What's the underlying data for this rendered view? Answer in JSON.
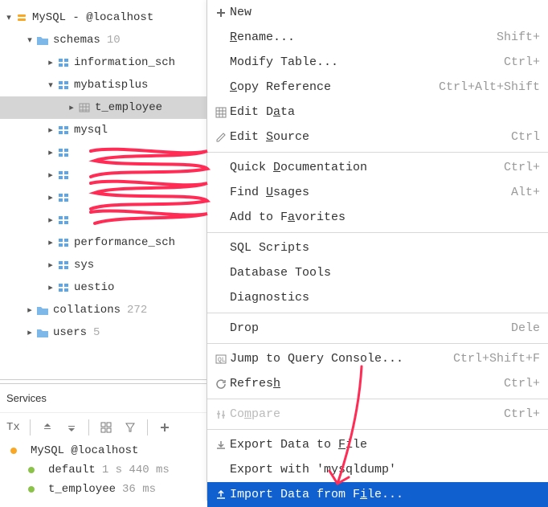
{
  "tree": {
    "root_label": "MySQL - @localhost",
    "schemas": {
      "label": "schemas",
      "count": "10",
      "items": [
        {
          "label": "information_sch",
          "expanded": false
        },
        {
          "label": "mybatisplus",
          "expanded": true,
          "children": [
            {
              "label": "t_employee"
            }
          ]
        },
        {
          "label": "mysql",
          "expanded": false
        },
        {
          "label": "",
          "redacted": true
        },
        {
          "label": "",
          "redacted": true
        },
        {
          "label": "",
          "redacted": true
        },
        {
          "label": "",
          "redacted": true
        },
        {
          "label": "performance_sch",
          "expanded": false
        },
        {
          "label": "sys",
          "expanded": false
        },
        {
          "label": "uestio",
          "expanded": false
        }
      ]
    },
    "collations": {
      "label": "collations",
      "count": "272"
    },
    "users": {
      "label": "users",
      "count": "5"
    }
  },
  "services": {
    "title": "Services",
    "label_tx": "Tx",
    "lines": [
      {
        "text": "MySQL  @localhost"
      },
      {
        "text": "default",
        "meta": "1 s 440 ms"
      },
      {
        "text": "t_employee",
        "meta": "36 ms"
      }
    ]
  },
  "menu": {
    "items": [
      {
        "label_html": "New",
        "icon": "plus"
      },
      {
        "label_html": "<u>R</u>ename...",
        "shortcut": "Shift+"
      },
      {
        "label_html": "Modify Table...",
        "shortcut": "Ctrl+"
      },
      {
        "label_html": "<u>C</u>opy Reference",
        "shortcut": "Ctrl+Alt+Shift"
      },
      {
        "label_html": "Edit D<u>a</u>ta",
        "icon": "grid"
      },
      {
        "label_html": "Edit <u>S</u>ource",
        "icon": "pencil",
        "shortcut": "Ctrl"
      },
      {
        "type": "sep"
      },
      {
        "label_html": "Quick <u>D</u>ocumentation",
        "shortcut": "Ctrl+"
      },
      {
        "label_html": "Find <u>U</u>sages",
        "shortcut": "Alt+"
      },
      {
        "label_html": "Add to F<u>a</u>vorites"
      },
      {
        "type": "sep"
      },
      {
        "label_html": "SQL Scripts"
      },
      {
        "label_html": "Database Tools"
      },
      {
        "label_html": "Diagnostics"
      },
      {
        "type": "sep"
      },
      {
        "label_html": "Drop",
        "shortcut": "Dele"
      },
      {
        "type": "sep"
      },
      {
        "label_html": "Jump to Query Console...",
        "icon": "ql",
        "shortcut": "Ctrl+Shift+F"
      },
      {
        "label_html": "Refres<u>h</u>",
        "icon": "refresh",
        "shortcut": "Ctrl+"
      },
      {
        "type": "sep"
      },
      {
        "label_html": "Co<u>m</u>pare",
        "icon": "compare",
        "disabled": true,
        "shortcut": "Ctrl+"
      },
      {
        "type": "sep"
      },
      {
        "label_html": "Export Data to <u>F</u>ile",
        "icon": "export"
      },
      {
        "label_html": "Export with 'mysqldump'"
      },
      {
        "label_html": "Import Data from F<u>i</u>le...",
        "icon": "import",
        "highlighted": true
      }
    ]
  }
}
